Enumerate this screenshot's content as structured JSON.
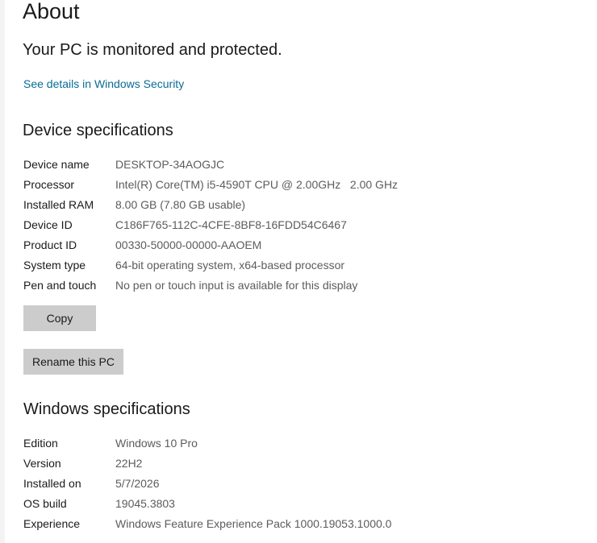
{
  "page": {
    "title": "About"
  },
  "security": {
    "status": "Your PC is monitored and protected.",
    "link": "See details in Windows Security"
  },
  "device_specs": {
    "heading": "Device specifications",
    "rows": [
      {
        "label": "Device name",
        "value": "DESKTOP-34AOGJC"
      },
      {
        "label": "Processor",
        "value": "Intel(R) Core(TM) i5-4590T CPU @ 2.00GHz   2.00 GHz"
      },
      {
        "label": "Installed RAM",
        "value": "8.00 GB (7.80 GB usable)"
      },
      {
        "label": "Device ID",
        "value": "C186F765-112C-4CFE-8BF8-16FDD54C6467"
      },
      {
        "label": "Product ID",
        "value": "00330-50000-00000-AAOEM"
      },
      {
        "label": "System type",
        "value": "64-bit operating system, x64-based processor"
      },
      {
        "label": "Pen and touch",
        "value": "No pen or touch input is available for this display"
      }
    ],
    "copy_button": "Copy",
    "rename_button": "Rename this PC"
  },
  "windows_specs": {
    "heading": "Windows specifications",
    "rows": [
      {
        "label": "Edition",
        "value": "Windows 10 Pro"
      },
      {
        "label": "Version",
        "value": "22H2"
      },
      {
        "label": "Installed on",
        "value": "5/7/2026"
      },
      {
        "label": "OS build",
        "value": "19045.3803"
      },
      {
        "label": "Experience",
        "value": "Windows Feature Experience Pack 1000.19053.1000.0"
      }
    ]
  }
}
